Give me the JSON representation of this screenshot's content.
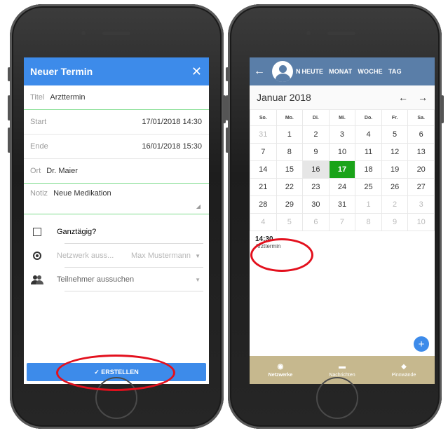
{
  "left": {
    "header": {
      "title": "Neuer Termin",
      "close": "✕"
    },
    "title_field": {
      "label": "Titel",
      "value": "Arzttermin"
    },
    "start_field": {
      "label": "Start",
      "value": "17/01/2018 14:30"
    },
    "end_field": {
      "label": "Ende",
      "value": "16/01/2018 15:30"
    },
    "location_field": {
      "label": "Ort",
      "value": "Dr. Maier"
    },
    "note_field": {
      "label": "Notiz",
      "value": "Neue Medikation"
    },
    "allday_label": "Ganztägig?",
    "network": {
      "placeholder": "Netzwerk auss...",
      "value": "Max Mustermann"
    },
    "participants_placeholder": "Teilnehmer aussuchen",
    "create_button": "✓ ERSTELLEN"
  },
  "right": {
    "header": {
      "back": "←",
      "nav_truncated": "N",
      "nav": [
        "HEUTE",
        "MONAT",
        "WOCHE",
        "TAG"
      ]
    },
    "month_title": "Januar 2018",
    "arrows": [
      "←",
      "→"
    ],
    "weekdays": [
      "So.",
      "Mo.",
      "Di.",
      "Mi.",
      "Do.",
      "Fr.",
      "Sa."
    ],
    "weeks": [
      [
        "31",
        "1",
        "2",
        "3",
        "4",
        "5",
        "6"
      ],
      [
        "7",
        "8",
        "9",
        "10",
        "11",
        "12",
        "13"
      ],
      [
        "14",
        "15",
        "16",
        "17",
        "18",
        "19",
        "20"
      ],
      [
        "21",
        "22",
        "23",
        "24",
        "25",
        "26",
        "27"
      ],
      [
        "28",
        "29",
        "30",
        "31",
        "1",
        "2",
        "3"
      ],
      [
        "4",
        "5",
        "6",
        "7",
        "8",
        "9",
        "10"
      ]
    ],
    "event": {
      "time": "14:30",
      "name": "Arzttermin"
    },
    "fab": "+",
    "bottom_nav": [
      {
        "label": "Netzwerke",
        "icon": "network-icon"
      },
      {
        "label": "Nachrichten",
        "icon": "chat-icon"
      },
      {
        "label": "Pinnwände",
        "icon": "tag-icon"
      }
    ]
  },
  "colors": {
    "blue": "#3d8bea",
    "header_blue": "#5a7ea8",
    "green": "#1aa319",
    "khaki": "#c6b88e",
    "annotation_red": "#e3101d"
  }
}
